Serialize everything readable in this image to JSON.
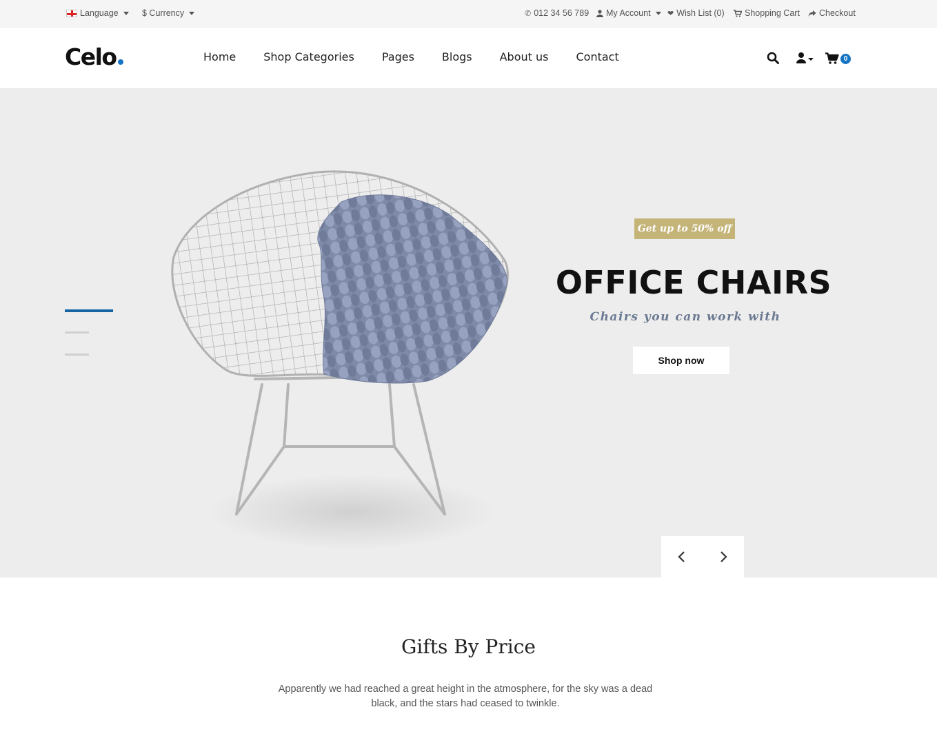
{
  "topbar": {
    "language_label": "Language",
    "currency_label": "$ Currency",
    "phone": "012 34 56 789",
    "account_label": "My Account",
    "wishlist_label": "Wish List (0)",
    "cart_label": "Shopping Cart",
    "checkout_label": "Checkout"
  },
  "header": {
    "logo_text": "Celo",
    "nav": [
      "Home",
      "Shop Categories",
      "Pages",
      "Blogs",
      "About us",
      "Contact"
    ],
    "cart_count": "0",
    "accent_color": "#1574c4"
  },
  "hero": {
    "badge": "Get up to 50% off",
    "title": "OFFICE CHAIRS",
    "subtitle": "Chairs you can work with",
    "button": "Shop now",
    "badge_color": "#c5b478",
    "slide_count": 3,
    "active_slide": 1
  },
  "gifts": {
    "title": "Gifts By Price",
    "description": "Apparently we had reached a great height in the atmosphere, for the sky was a dead black, and the stars had ceased to twinkle."
  }
}
